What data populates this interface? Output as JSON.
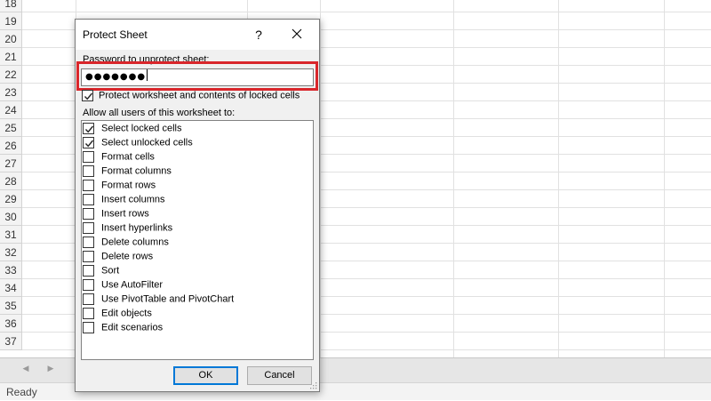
{
  "spreadsheet": {
    "row_numbers": [
      "18",
      "19",
      "20",
      "21",
      "22",
      "23",
      "24",
      "25",
      "26",
      "27",
      "28",
      "29",
      "30",
      "31",
      "32",
      "33",
      "34",
      "35",
      "36",
      "37"
    ],
    "status": "Ready"
  },
  "dialog": {
    "title": "Protect Sheet",
    "help_label": "?",
    "password_label": "Password to unprotect sheet:",
    "password_value": "●●●●●●●",
    "protect_option": {
      "label": "Protect worksheet and contents of locked cells",
      "checked": true
    },
    "allow_label": "Allow all users of this worksheet to:",
    "permissions": [
      {
        "label": "Select locked cells",
        "checked": true
      },
      {
        "label": "Select unlocked cells",
        "checked": true
      },
      {
        "label": "Format cells",
        "checked": false
      },
      {
        "label": "Format columns",
        "checked": false
      },
      {
        "label": "Format rows",
        "checked": false
      },
      {
        "label": "Insert columns",
        "checked": false
      },
      {
        "label": "Insert rows",
        "checked": false
      },
      {
        "label": "Insert hyperlinks",
        "checked": false
      },
      {
        "label": "Delete columns",
        "checked": false
      },
      {
        "label": "Delete rows",
        "checked": false
      },
      {
        "label": "Sort",
        "checked": false
      },
      {
        "label": "Use AutoFilter",
        "checked": false
      },
      {
        "label": "Use PivotTable and PivotChart",
        "checked": false
      },
      {
        "label": "Edit objects",
        "checked": false
      },
      {
        "label": "Edit scenarios",
        "checked": false
      }
    ],
    "ok_label": "OK",
    "cancel_label": "Cancel"
  },
  "colors": {
    "highlight_border": "#d9262b",
    "default_button_border": "#0078d7"
  },
  "icons": {
    "close": "close-icon",
    "check": "checkmark-icon",
    "grip": "resize-grip-icon"
  }
}
